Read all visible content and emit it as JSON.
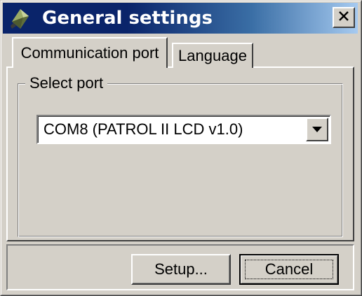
{
  "window": {
    "title": "General settings",
    "app_icon": "diamond-app-icon",
    "close_icon": "close-x-icon",
    "titlebar_colors": [
      "#0a246a",
      "#a6caf0"
    ]
  },
  "tabs": [
    {
      "label": "Communication port",
      "active": true
    },
    {
      "label": "Language",
      "active": false
    }
  ],
  "group": {
    "label": "Select port"
  },
  "port_select": {
    "selected": "COM8 (PATROL II LCD v1.0)",
    "arrow_icon": "chevron-down-icon"
  },
  "buttons": {
    "setup_label": "Setup...",
    "cancel_label": "Cancel"
  }
}
